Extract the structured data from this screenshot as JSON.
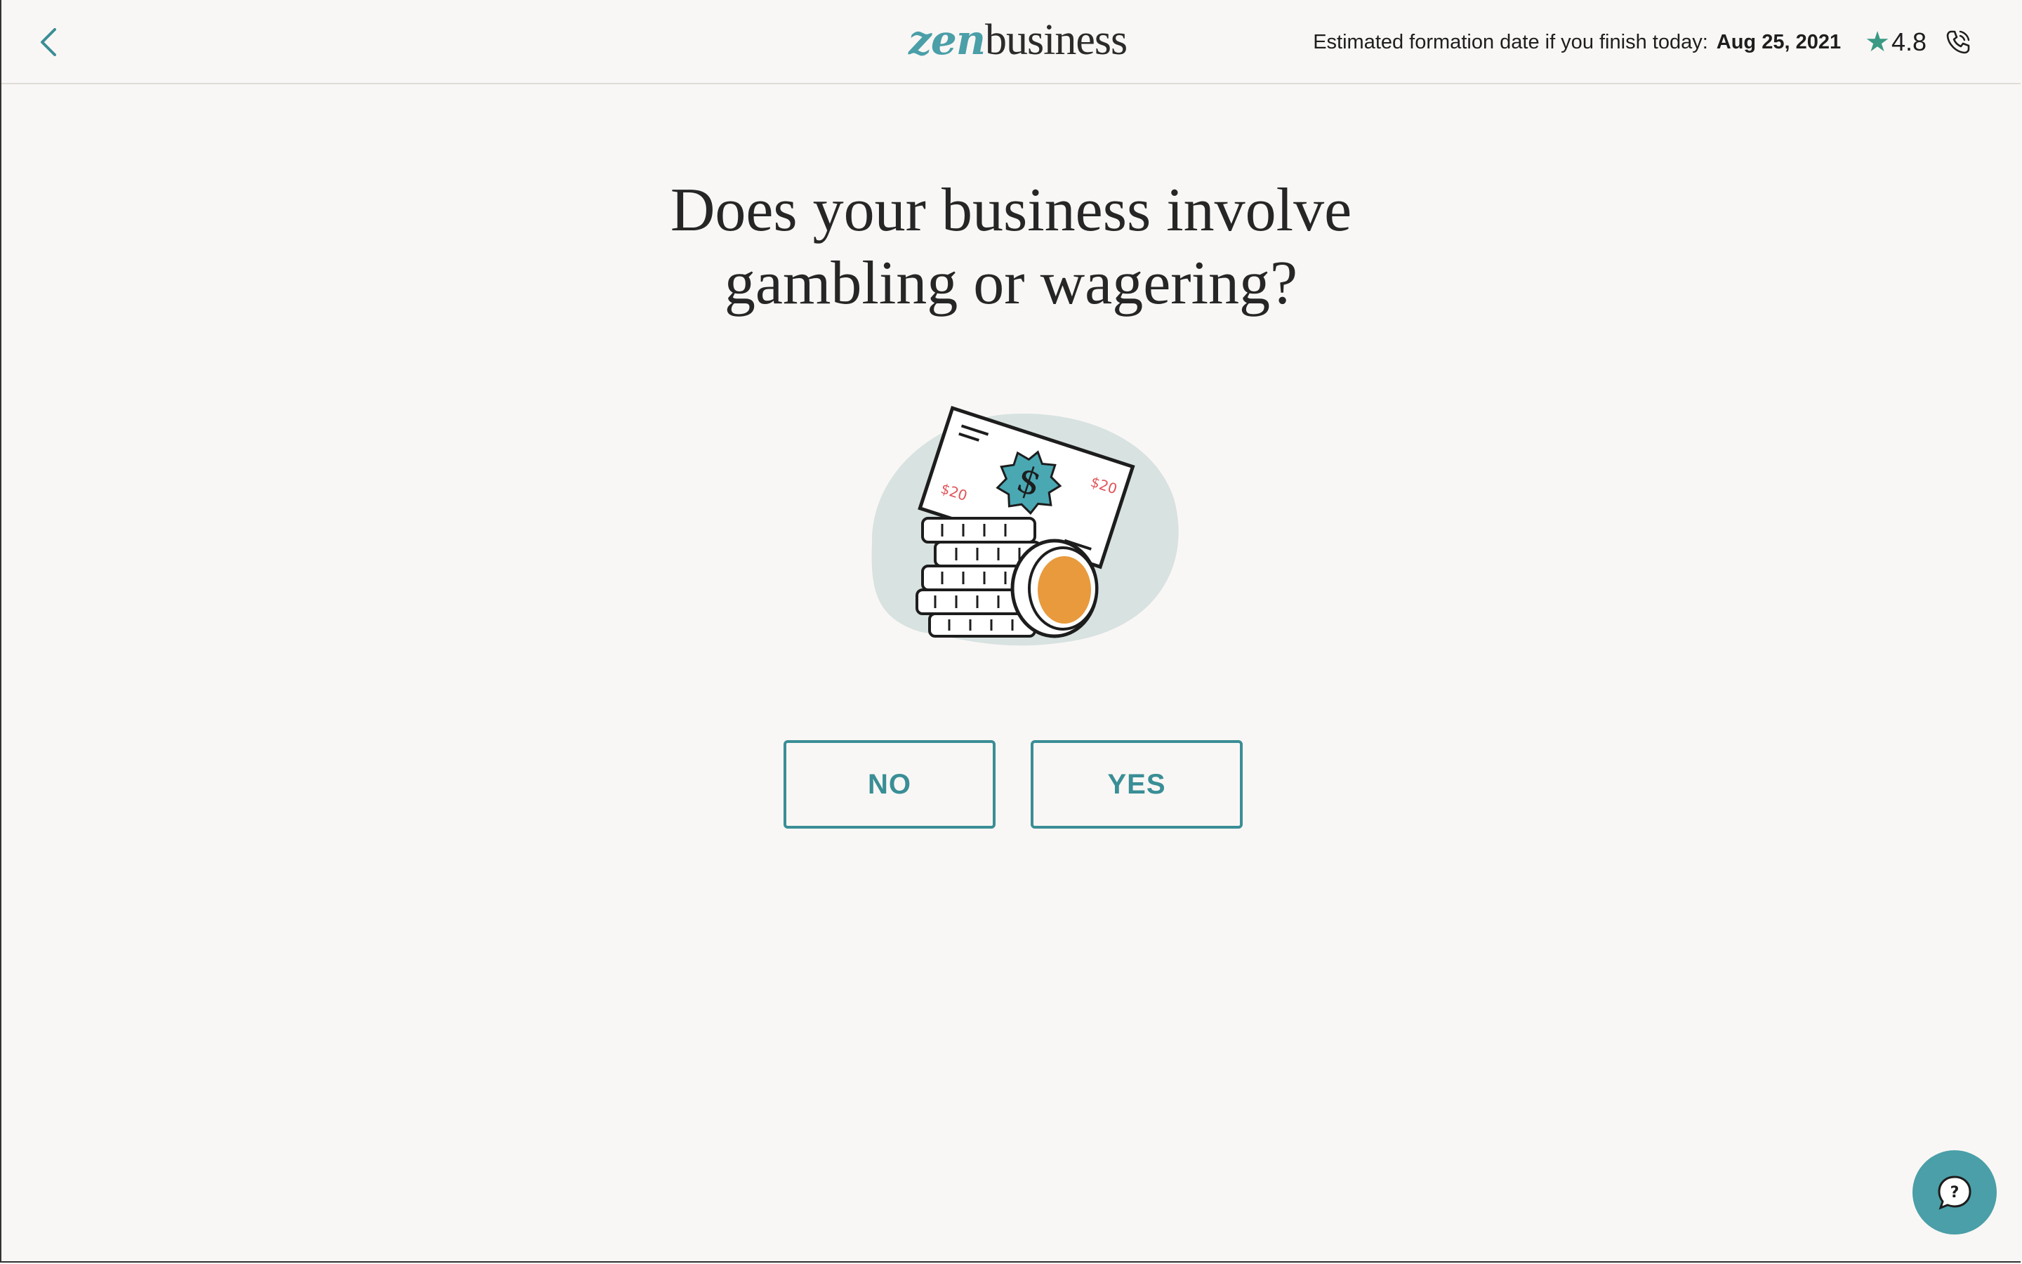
{
  "header": {
    "logo_prefix": "zen",
    "logo_suffix": "business",
    "formation_label": "Estimated formation date if you finish today:",
    "formation_date": "Aug 25, 2021",
    "rating": "4.8",
    "icons": {
      "back": "chevron-left-icon",
      "star": "star-icon",
      "phone": "phone-icon"
    }
  },
  "question": {
    "line1": "Does your business involve",
    "line2": "gambling or wagering?"
  },
  "illustration": {
    "bill_label": "$20",
    "icon": "money-illustration"
  },
  "answers": {
    "no_label": "NO",
    "yes_label": "YES"
  },
  "help": {
    "glyph": "?",
    "icon": "chat-help-icon"
  },
  "colors": {
    "accent": "#4a9fa8",
    "button_border": "#3a8e96",
    "background": "#f9f7f5",
    "star": "#3a9a84",
    "coin": "#e89a3c"
  }
}
